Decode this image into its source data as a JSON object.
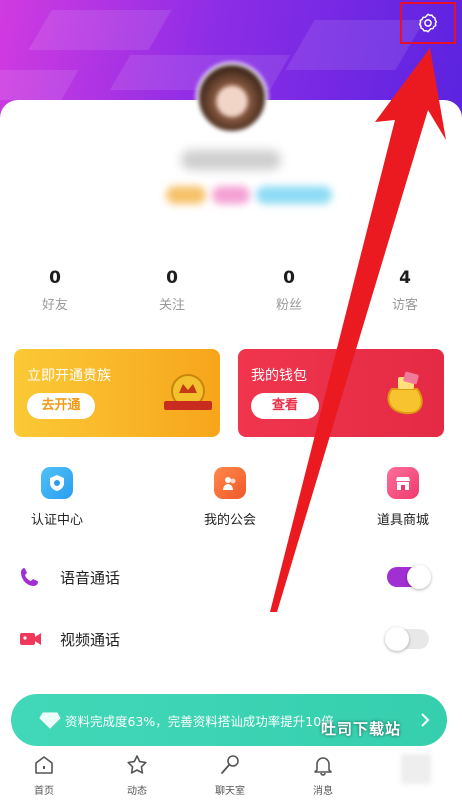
{
  "header": {
    "settings_icon": "gear-icon"
  },
  "profile": {
    "avatar": "blurred-avatar-photo"
  },
  "stats": [
    {
      "value": "0",
      "label": "好友"
    },
    {
      "value": "0",
      "label": "关注"
    },
    {
      "value": "0",
      "label": "粉丝"
    },
    {
      "value": "4",
      "label": "访客"
    }
  ],
  "promos": {
    "vip": {
      "title": "立即开通贵族",
      "button": "去开通",
      "color": "#f7b32b"
    },
    "wallet": {
      "title": "我的钱包",
      "button": "查看",
      "color": "#ee2f4b"
    }
  },
  "quick_links": [
    {
      "label": "认证中心",
      "icon": "certification-icon"
    },
    {
      "label": "我的公会",
      "icon": "guild-icon"
    },
    {
      "label": "道具商城",
      "icon": "store-icon"
    }
  ],
  "calls": {
    "voice": {
      "label": "语音通话",
      "enabled": true
    },
    "video": {
      "label": "视频通话",
      "enabled": false
    }
  },
  "banner": {
    "text": "资料完成度63%，完善资料搭讪成功率提升10倍"
  },
  "watermark": "吐司下载站",
  "tabs": [
    {
      "label": "首页",
      "icon": "home-icon"
    },
    {
      "label": "动态",
      "icon": "star-icon"
    },
    {
      "label": "聊天室",
      "icon": "microphone-icon"
    },
    {
      "label": "消息",
      "icon": "bell-icon"
    }
  ],
  "colors": {
    "header_start": "#d13be0",
    "header_end": "#5a23e0",
    "accent_purple": "#9b2fd6",
    "annotation_red": "#e6102a",
    "banner_teal": "#3fd5b4"
  }
}
